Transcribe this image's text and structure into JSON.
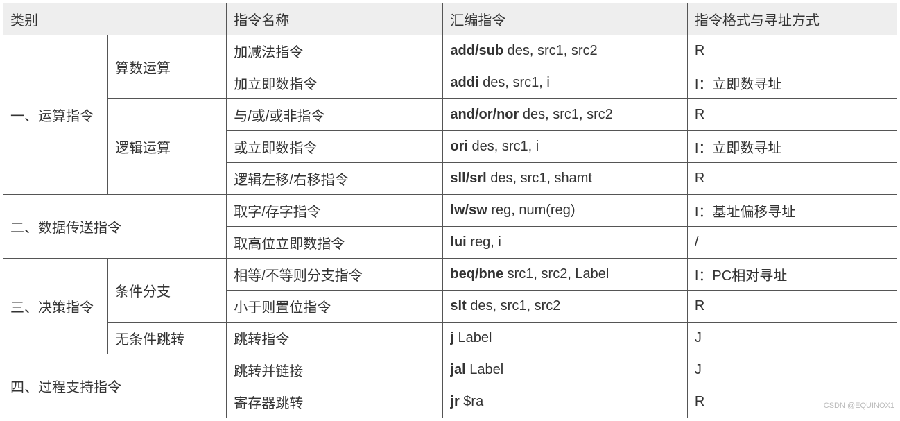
{
  "headers": {
    "category": "类别",
    "name": "指令名称",
    "asm": "汇编指令",
    "format": "指令格式与寻址方式"
  },
  "cat1": {
    "label": "一、运算指令"
  },
  "cat1a": {
    "label": "算数运算"
  },
  "cat1b": {
    "label": "逻辑运算"
  },
  "cat2": {
    "label": "二、数据传送指令"
  },
  "cat3": {
    "label": "三、决策指令"
  },
  "cat3a": {
    "label": "条件分支"
  },
  "cat3b": {
    "label": "无条件跳转"
  },
  "cat4": {
    "label": "四、过程支持指令"
  },
  "rows": {
    "r1": {
      "name": "加减法指令",
      "asm_bold": "add/sub",
      "asm_rest": " des, src1, src2",
      "format": "R"
    },
    "r2": {
      "name": "加立即数指令",
      "asm_bold": "addi",
      "asm_rest": " des, src1, i",
      "format": "I：立即数寻址"
    },
    "r3": {
      "name": "与/或/或非指令",
      "asm_bold": "and/or/nor",
      "asm_rest": " des, src1, src2",
      "format": "R"
    },
    "r4": {
      "name": "或立即数指令",
      "asm_bold": "ori",
      "asm_rest": " des, src1, i",
      "format": "I：立即数寻址"
    },
    "r5": {
      "name": "逻辑左移/右移指令",
      "asm_bold": "sll/srl",
      "asm_rest": " des, src1, shamt",
      "format": "R"
    },
    "r6": {
      "name": "取字/存字指令",
      "asm_bold": "lw/sw",
      "asm_rest": " reg, num(reg)",
      "format": "I：基址偏移寻址"
    },
    "r7": {
      "name": "取高位立即数指令",
      "asm_bold": "lui",
      "asm_rest": " reg, i",
      "format": "/"
    },
    "r8": {
      "name": "相等/不等则分支指令",
      "asm_bold": "beq/bne",
      "asm_rest": " src1, src2, Label",
      "format": "I：PC相对寻址"
    },
    "r9": {
      "name": "小于则置位指令",
      "asm_bold": "slt",
      "asm_rest": " des, src1, src2",
      "format": "R"
    },
    "r10": {
      "name": "跳转指令",
      "asm_bold": "j",
      "asm_rest": " Label",
      "format": "J"
    },
    "r11": {
      "name": "跳转并链接",
      "asm_bold": "jal",
      "asm_rest": " Label",
      "format": "J"
    },
    "r12": {
      "name": "寄存器跳转",
      "asm_bold": "jr",
      "asm_rest": " $ra",
      "format": "R"
    }
  },
  "watermark": "CSDN @EQUINOX1"
}
